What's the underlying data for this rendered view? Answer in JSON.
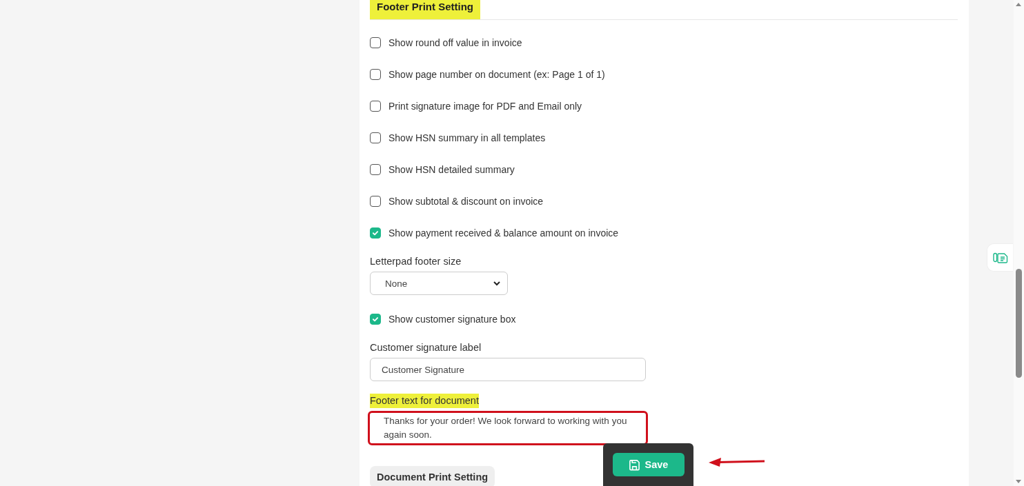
{
  "section": {
    "title": "Footer Print Setting",
    "highlighted": true
  },
  "fields": [
    {
      "kind": "checkbox",
      "label": "Show round off value in invoice",
      "checked": false
    },
    {
      "kind": "checkbox",
      "label": "Show page number on document (ex: Page 1 of 1)",
      "checked": false
    },
    {
      "kind": "checkbox",
      "label": "Print signature image for PDF and Email only",
      "checked": false
    },
    {
      "kind": "checkbox",
      "label": "Show HSN summary in all templates",
      "checked": false
    },
    {
      "kind": "checkbox",
      "label": "Show HSN detailed summary",
      "checked": false
    },
    {
      "kind": "checkbox",
      "label": "Show subtotal & discount on invoice",
      "checked": false
    },
    {
      "kind": "checkbox",
      "label": "Show payment received & balance amount on invoice",
      "checked": true
    },
    {
      "kind": "select",
      "label": "Letterpad footer size",
      "value": "None",
      "highlighted": false,
      "outlined": false
    },
    {
      "kind": "checkbox",
      "label": "Show customer signature box",
      "checked": true
    },
    {
      "kind": "text",
      "label": "Customer signature label",
      "value": "Customer Signature",
      "highlighted": false,
      "outlined": false
    },
    {
      "kind": "textarea",
      "label": "Footer text for document",
      "value": "Thanks for your order! We look forward to working with you again soon.",
      "highlighted": true,
      "outlined": true
    }
  ],
  "next_section": {
    "title": "Document Print Setting"
  },
  "save_button": {
    "label": "Save"
  }
}
